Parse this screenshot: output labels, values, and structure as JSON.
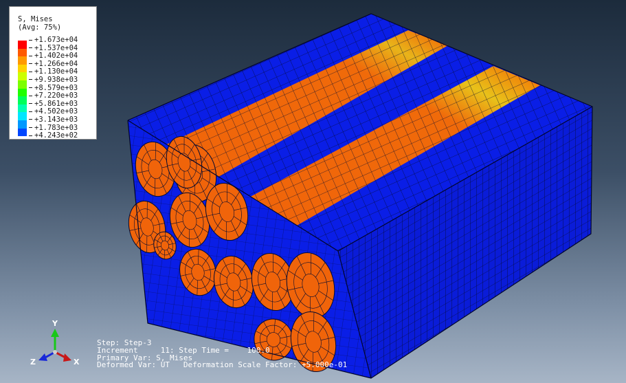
{
  "legend": {
    "title": "S, Mises",
    "subtitle": "(Avg: 75%)",
    "levels": [
      {
        "value": "+1.673e+04",
        "color": "#ff0000"
      },
      {
        "value": "+1.537e+04",
        "color": "#ff5a00"
      },
      {
        "value": "+1.402e+04",
        "color": "#ff9a00"
      },
      {
        "value": "+1.266e+04",
        "color": "#ffd200"
      },
      {
        "value": "+1.130e+04",
        "color": "#ccff00"
      },
      {
        "value": "+9.938e+03",
        "color": "#7cff00"
      },
      {
        "value": "+8.579e+03",
        "color": "#20ff00"
      },
      {
        "value": "+7.220e+03",
        "color": "#00ff5a"
      },
      {
        "value": "+5.861e+03",
        "color": "#00ffb0"
      },
      {
        "value": "+4.502e+03",
        "color": "#00e6ff"
      },
      {
        "value": "+3.143e+03",
        "color": "#0098ff"
      },
      {
        "value": "+1.783e+03",
        "color": "#0046ff"
      },
      {
        "value": "+4.243e+02",
        "color": "#0000ff"
      }
    ]
  },
  "step_info": {
    "line1": "Step: Step-3",
    "line2": "Increment     11: Step Time =    100.0",
    "line3": "Primary Var: S, Mises",
    "line4": "Deformed Var: UT   Deformation Scale Factor: +5.000e-01"
  },
  "triad": {
    "x_label": "X",
    "y_label": "Y",
    "z_label": "Z"
  },
  "colors": {
    "matrix": "#0a1ee6",
    "fiber": "#f0640a",
    "fiber_hot": "#e8c11a",
    "peak": "#ff1200",
    "mesh_line": "#050a30"
  }
}
